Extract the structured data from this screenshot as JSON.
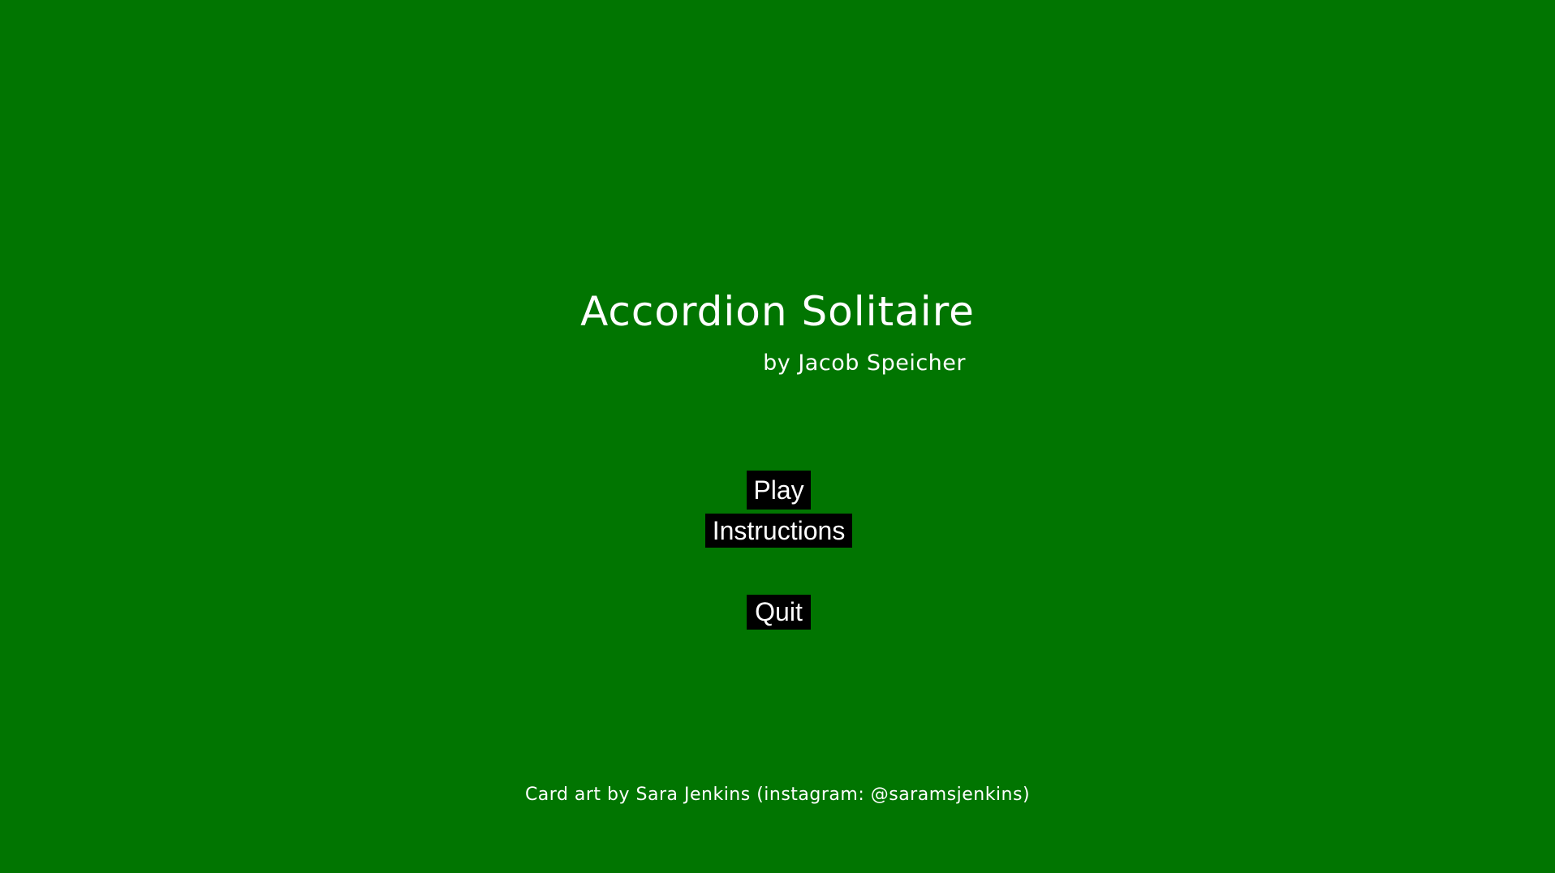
{
  "game": {
    "title": "Accordion Solitaire",
    "author": "by Jacob Speicher",
    "credits": "Card art by Sara Jenkins (instagram: @saramsjenkins)"
  },
  "menu": {
    "play_label": "Play",
    "instructions_label": "Instructions",
    "quit_label": "Quit"
  },
  "colors": {
    "background": "#017501",
    "button_background": "#000000",
    "text": "#ffffff"
  }
}
